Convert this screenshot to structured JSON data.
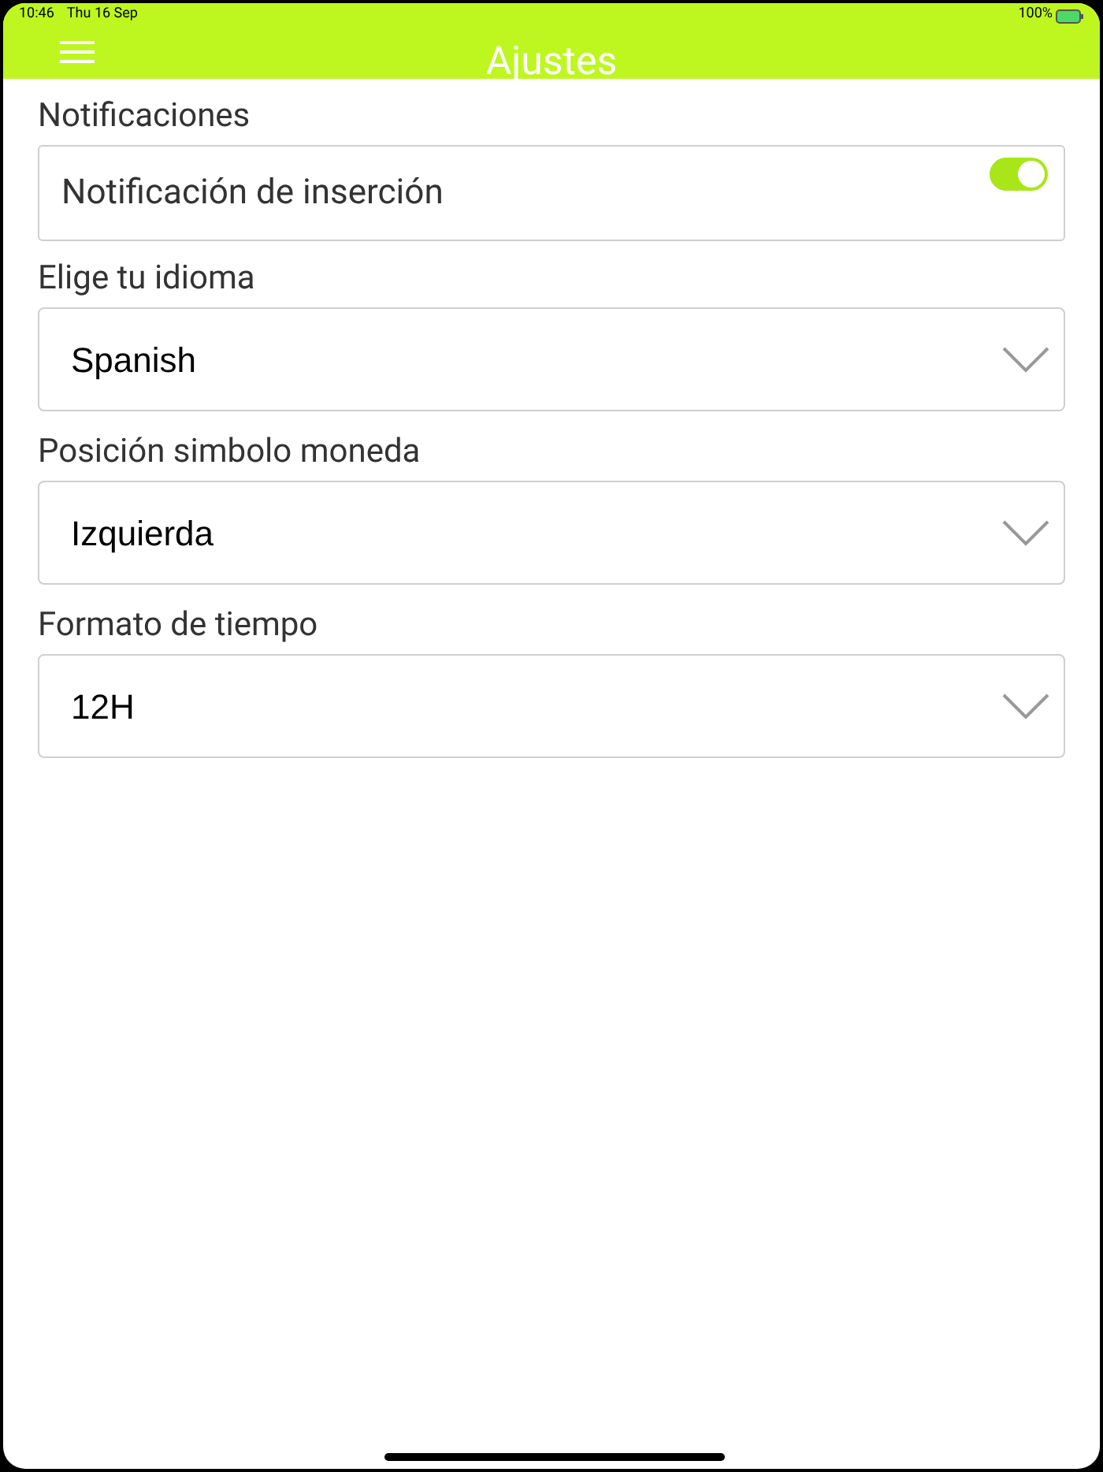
{
  "status_bar": {
    "time": "10:46",
    "date": "Thu 16 Sep",
    "battery": "100%"
  },
  "header": {
    "title": "Ajustes"
  },
  "sections": [
    {
      "kind": "toggle",
      "label": "Notificaciones",
      "text": "Notificación de inserción",
      "on": true
    },
    {
      "kind": "select",
      "label": "Elige tu idioma",
      "value": "Spanish"
    },
    {
      "kind": "select",
      "label": "Posición simbolo moneda",
      "value": "Izquierda"
    },
    {
      "kind": "select",
      "label": "Formato de tiempo",
      "value": "12H"
    }
  ]
}
